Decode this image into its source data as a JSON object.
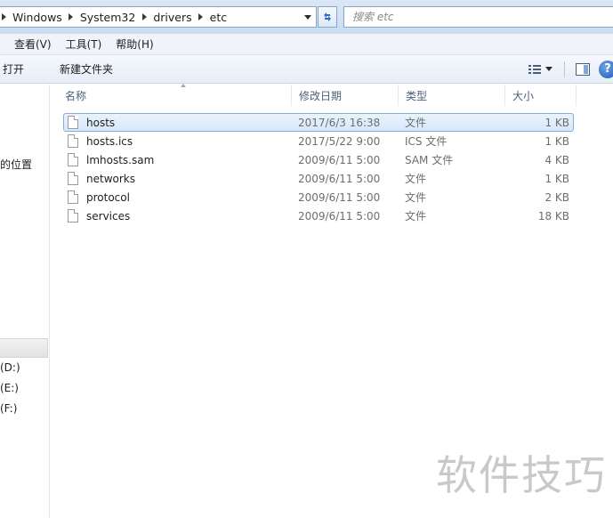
{
  "address": {
    "crumbs": [
      "Windows",
      "System32",
      "drivers",
      "etc"
    ]
  },
  "search": {
    "placeholder": "搜索 etc"
  },
  "menu": {
    "items": [
      "查看(V)",
      "工具(T)",
      "帮助(H)"
    ]
  },
  "toolbar": {
    "open_label": "打开",
    "new_folder_label": "新建文件夹"
  },
  "nav": {
    "items": [
      "的位置",
      "(D:)",
      "(E:)",
      "(F:)"
    ]
  },
  "columns": [
    "名称",
    "修改日期",
    "类型",
    "大小"
  ],
  "files": [
    {
      "name": "hosts",
      "date": "2017/6/3 16:38",
      "type": "文件",
      "size": "1 KB",
      "selected": true
    },
    {
      "name": "hosts.ics",
      "date": "2017/5/22 9:00",
      "type": "ICS 文件",
      "size": "1 KB",
      "selected": false
    },
    {
      "name": "lmhosts.sam",
      "date": "2009/6/11 5:00",
      "type": "SAM 文件",
      "size": "4 KB",
      "selected": false
    },
    {
      "name": "networks",
      "date": "2009/6/11 5:00",
      "type": "文件",
      "size": "1 KB",
      "selected": false
    },
    {
      "name": "protocol",
      "date": "2009/6/11 5:00",
      "type": "文件",
      "size": "2 KB",
      "selected": false
    },
    {
      "name": "services",
      "date": "2009/6/11 5:00",
      "type": "文件",
      "size": "18 KB",
      "selected": false
    }
  ],
  "watermark": "软件技巧"
}
